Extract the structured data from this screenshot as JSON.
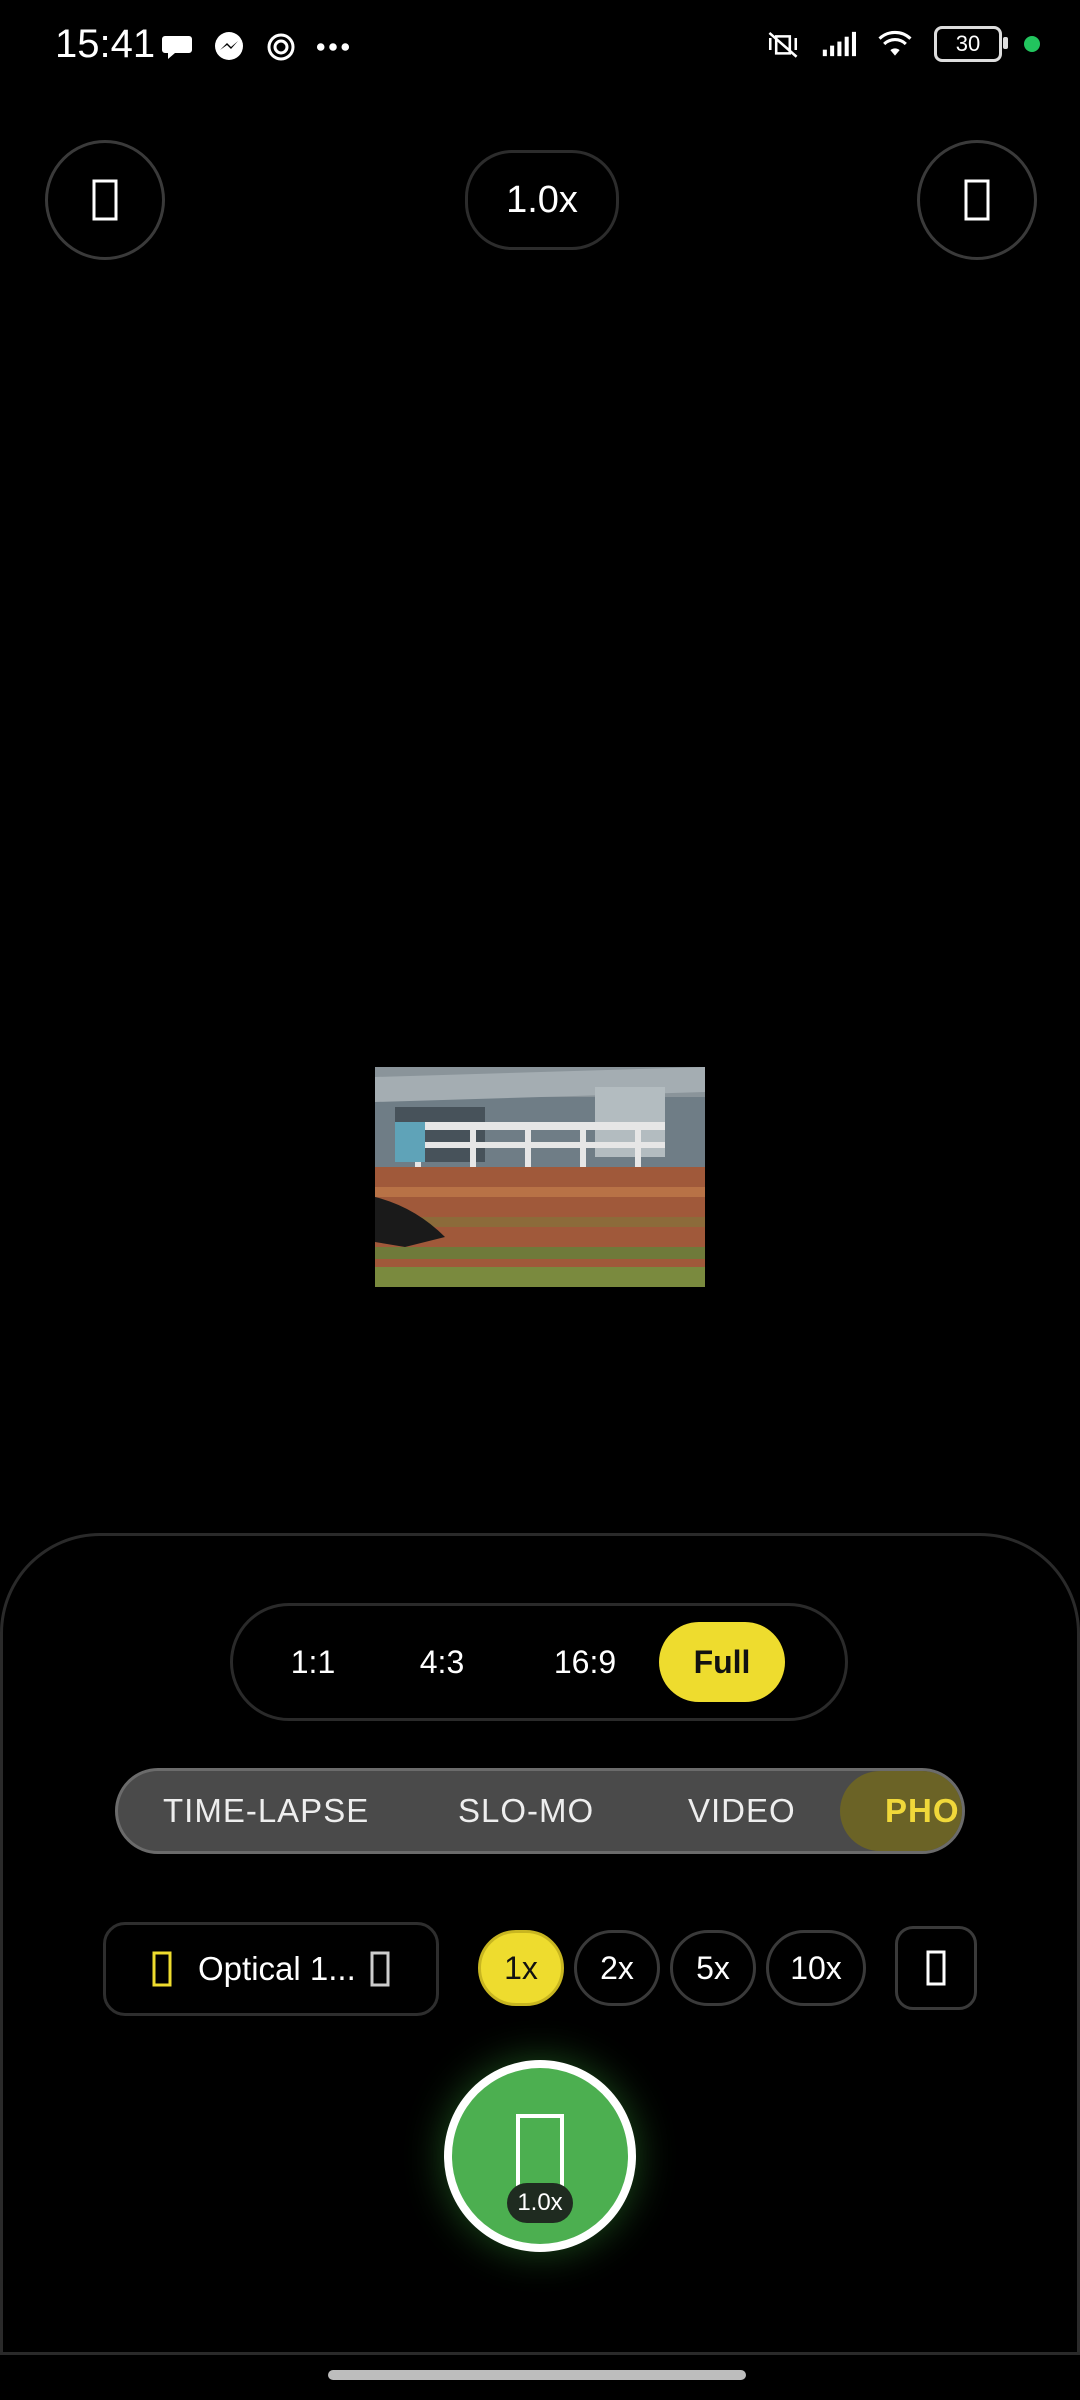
{
  "status_bar": {
    "time": "15:41",
    "battery": "30",
    "left_icons": [
      "chat-bubble-icon",
      "messenger-icon",
      "swirl-app-icon",
      "more-dots-icon"
    ],
    "right_icons": [
      "vibrate-off-icon",
      "signal-icon",
      "wifi-icon",
      "battery-icon"
    ]
  },
  "top_bar": {
    "zoom_label": "1.0x",
    "left_icon": "settings-icon",
    "right_icon": "flash-icon"
  },
  "aspect_ratios": {
    "options": [
      "1:1",
      "4:3",
      "16:9",
      "Full"
    ],
    "selected": "Full"
  },
  "modes": {
    "items": [
      "TIME-LAPSE",
      "SLO-MO",
      "VIDEO",
      "PHOTO"
    ],
    "selected": "PHOTO",
    "visible_active_text": "PHO"
  },
  "lens": {
    "label": "Optical 1...",
    "zoom_levels": [
      "1x",
      "2x",
      "5x",
      "10x"
    ],
    "selected_zoom": "1x"
  },
  "shutter": {
    "badge": "1.0x"
  },
  "colors": {
    "accent_yellow": "#eedc2e",
    "shutter_green": "#4caf50",
    "background": "#000000"
  }
}
